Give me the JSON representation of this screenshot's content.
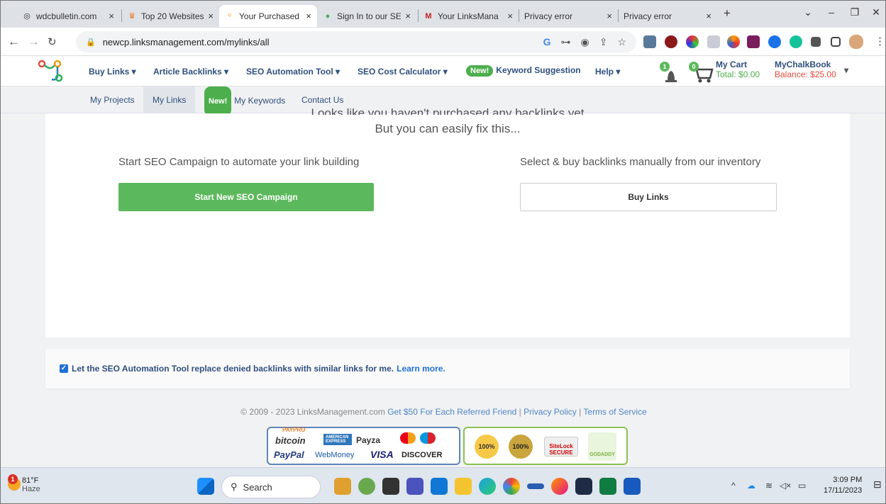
{
  "browser": {
    "tabs": [
      {
        "title": "wdcbulletin.com",
        "active": false
      },
      {
        "title": "Top 20 Websites",
        "active": false
      },
      {
        "title": "Your Purchased",
        "active": true
      },
      {
        "title": "Sign In to our SE",
        "active": false
      },
      {
        "title": "Your LinksMana",
        "active": false
      },
      {
        "title": "Privacy error",
        "active": false
      },
      {
        "title": "Privacy error",
        "active": false
      }
    ],
    "close_glyph": "×",
    "new_tab": "+",
    "url": "newcp.linksmanagement.com/mylinks/all",
    "omni_glyphs": [
      "G",
      "⊶",
      "◉",
      "⇪",
      "☆"
    ]
  },
  "site": {
    "menu": [
      {
        "label": "Buy Links ▾"
      },
      {
        "label": "Article Backlinks ▾"
      },
      {
        "label": "SEO Automation Tool ▾"
      },
      {
        "label": "SEO Cost Calculator ▾"
      },
      {
        "label": "Keyword Suggestion",
        "badge": "New!"
      },
      {
        "label": "Help ▾"
      }
    ],
    "notifications_count": "1",
    "cart_count": "0",
    "cart": {
      "label": "My Cart",
      "total": "Total: $0.00"
    },
    "account": {
      "name": "MyChalkBook",
      "balance": "Balance: $25.00",
      "caret": "▾"
    },
    "subnav": [
      {
        "label": "My Projects"
      },
      {
        "label": "My Links",
        "active": true
      },
      {
        "label": "My Keywords",
        "badge": "New!"
      },
      {
        "label": "Contact Us"
      }
    ]
  },
  "main": {
    "cut_heading": "Looks like you haven't purchased any backlinks yet",
    "fix_text": "But you can easily fix this...",
    "left_title": "Start SEO Campaign to automate your link building",
    "left_button": "Start New SEO Campaign",
    "right_title": "Select & buy backlinks manually from our inventory",
    "right_button": "Buy Links",
    "option_text": "Let the SEO Automation Tool replace denied backlinks with similar links for me.",
    "option_link": "Learn more.",
    "option_checked": true
  },
  "footer": {
    "copyright": "© 2009 - 2023 LinksManagement.com",
    "referral": "Get $50 For Each Referred Friend",
    "privacy": "Privacy Policy",
    "terms": "Terms of Service",
    "sep": "|",
    "payments": [
      "PAYPRO",
      "bitcoin",
      "AMERICAN EXPRESS",
      "Payza",
      "PayPal",
      "WebMoney",
      "VISA",
      "DISCOVER"
    ],
    "seals": [
      "100%",
      "100%",
      "SiteLock SECURE",
      "GODADDY"
    ]
  },
  "taskbar": {
    "weather_temp": "81°F",
    "weather_desc": "Haze",
    "weather_badge": "1",
    "search": "Search",
    "time": "3:09 PM",
    "date": "17/11/2023"
  },
  "colors": {
    "accent_green": "#5cb85c",
    "nav_text": "#2f4f7f",
    "balance_red": "#e64b3c"
  }
}
